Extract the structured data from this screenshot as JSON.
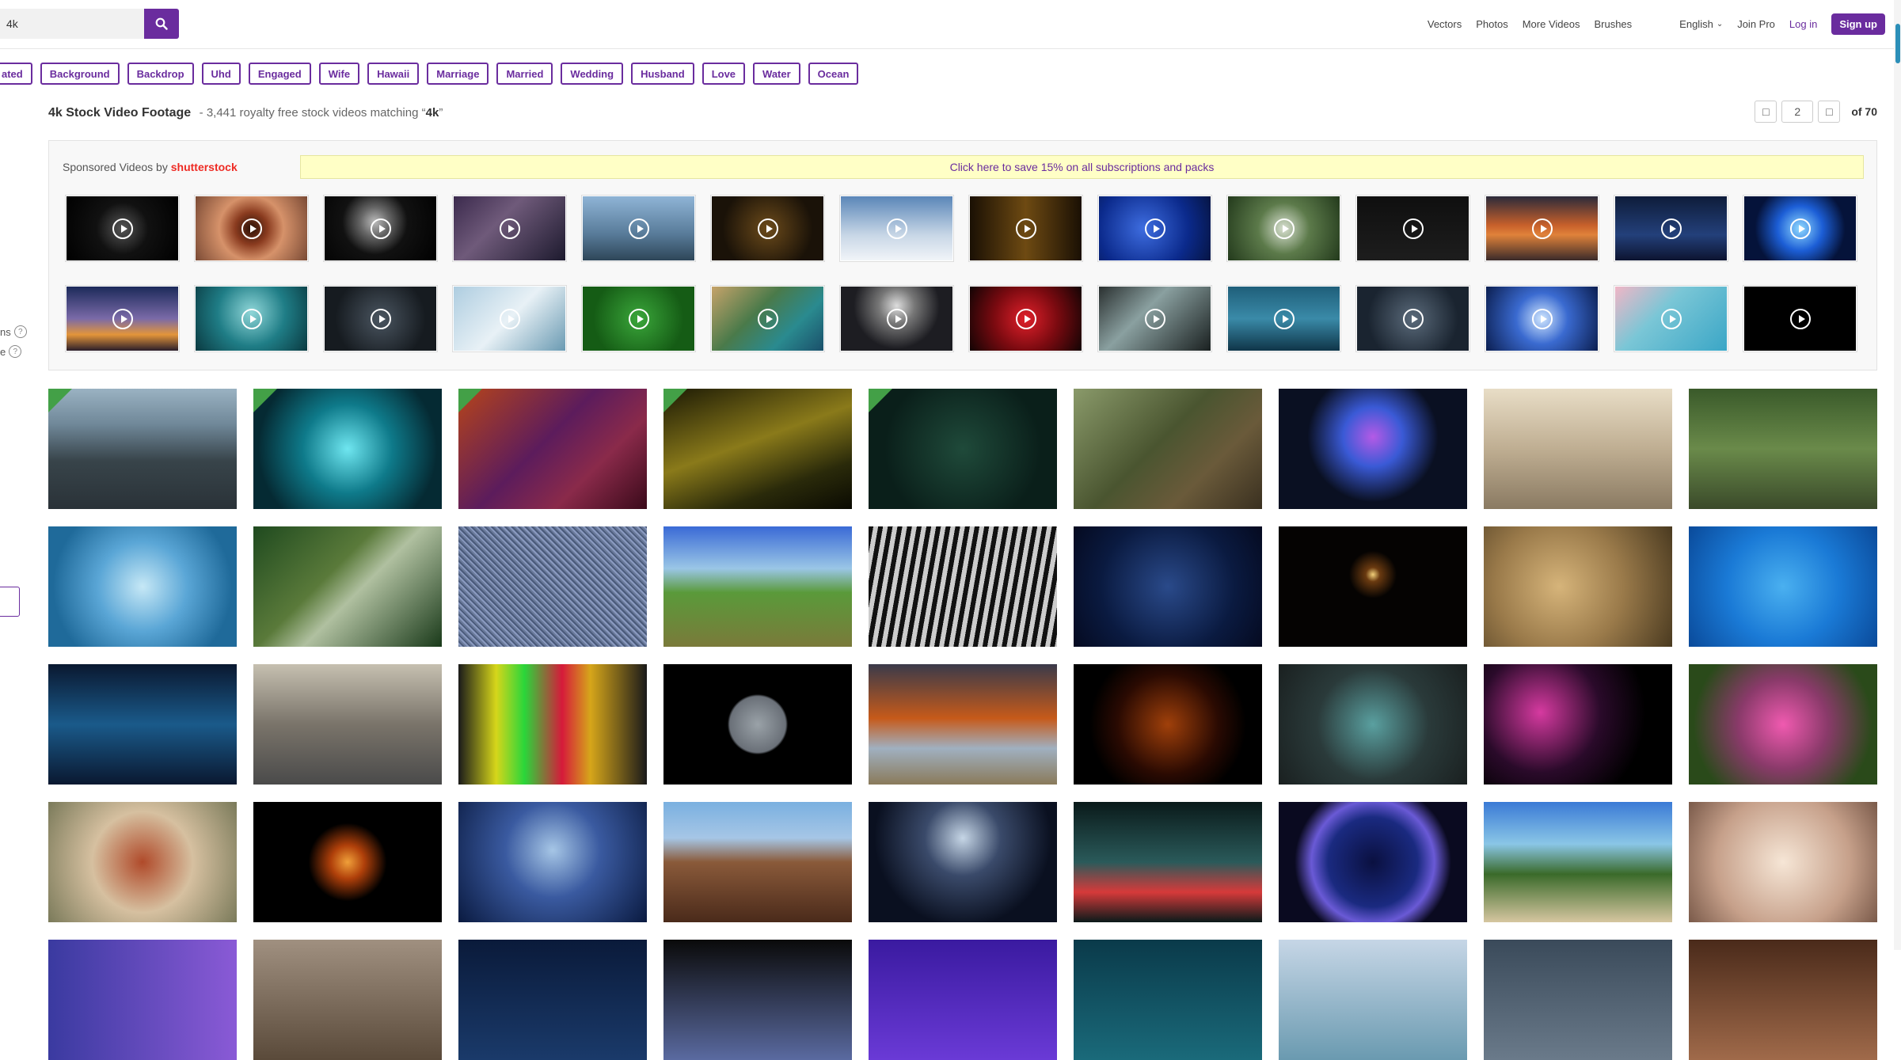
{
  "search": {
    "value": "4k",
    "placeholder": ""
  },
  "nav": {
    "links": [
      "Vectors",
      "Photos",
      "More Videos",
      "Brushes"
    ],
    "language": "English",
    "join_pro": "Join Pro",
    "login": "Log in",
    "signup": "Sign up"
  },
  "tags": [
    "ated",
    "Background",
    "Backdrop",
    "Uhd",
    "Engaged",
    "Wife",
    "Hawaii",
    "Marriage",
    "Married",
    "Wedding",
    "Husband",
    "Love",
    "Water",
    "Ocean"
  ],
  "heading": {
    "title": "4k Stock Video Footage",
    "subtitle": "- 3,441 royalty free stock videos matching “",
    "query": "4k",
    "close_quote": "”"
  },
  "pagination": {
    "current": "2",
    "total_label": "of 70"
  },
  "filters": {
    "fragment_1": "ns",
    "fragment_2": "e"
  },
  "sponsored": {
    "label": "Sponsored Videos by",
    "brand": "shutterstock",
    "promo": "Click here to save 15% on all subscriptions and packs"
  },
  "colors": {
    "accent": "#6a2c9e",
    "pro_badge": "#43a047",
    "promo_bg": "#ffffc6"
  },
  "sponsored_thumbs": [
    {
      "name": "dark-particles-ring",
      "bg": "radial-gradient(circle at 50% 50%, #555 0%, #111 40%, #000 100%)"
    },
    {
      "name": "eye-closeup",
      "bg": "radial-gradient(circle at 50% 50%, #2b1208 0%, #8a3b1f 25%, #d6926a 50%, #7a4a35 100%)"
    },
    {
      "name": "moon-dark",
      "bg": "radial-gradient(circle at 45% 40%, #bbb 0%, #666 20%, #111 45%, #000 100%)"
    },
    {
      "name": "galaxy",
      "bg": "linear-gradient(135deg, #3b2a4d, #6f5a7a 40%, #1d1a2e)"
    },
    {
      "name": "city-skyline",
      "bg": "linear-gradient(180deg, #8fb4d6, #577a98 60%, #2e4658)"
    },
    {
      "name": "gold-particles",
      "bg": "radial-gradient(circle at 50% 50%, #6b4a1a, #1a1208 70%)"
    },
    {
      "name": "clouds",
      "bg": "linear-gradient(180deg, #5a86b8, #c7d6e6 60%, #f1f4f8)"
    },
    {
      "name": "gold-chevrons",
      "bg": "linear-gradient(90deg, #1a1004, #6e4a12 50%, #1a1004)"
    },
    {
      "name": "blue-abstract",
      "bg": "radial-gradient(circle at 40% 50%, #3e6de0, #0b2a8c 60%, #061544)"
    },
    {
      "name": "forest-canopy",
      "bg": "radial-gradient(circle at 50% 50%, #d8e0d0, #5c7a4a 40%, #233a1c)"
    },
    {
      "name": "emoji-grid",
      "bg": "linear-gradient(180deg, #0f0f0f, #1d1d1d)"
    },
    {
      "name": "sunset-ocean",
      "bg": "linear-gradient(180deg, #2b2a3a, #c7602b 45%, #e0823a 60%, #3a2a2a)"
    },
    {
      "name": "night-city",
      "bg": "linear-gradient(180deg, #0e1c3a, #23407a 60%, #0d1430)"
    },
    {
      "name": "blue-ring",
      "bg": "radial-gradient(circle at 50% 50%, #8fd9ff, #1c5ed6 35%, #05133a 70%)"
    },
    {
      "name": "skyline-dusk",
      "bg": "linear-gradient(180deg, #1c2a5a, #7a6aa8 50%, #e3953a 75%, #2a1d2a)"
    },
    {
      "name": "underwater-teal",
      "bg": "radial-gradient(circle at 50% 40%, #8fd6d8, #1f7d86 50%, #0a3940)"
    },
    {
      "name": "dark-storm",
      "bg": "radial-gradient(circle at 50% 50%, #4a5560, #161b20 70%)"
    },
    {
      "name": "glacier",
      "bg": "linear-gradient(135deg, #aecde0, #e8f1f6 50%, #6a9ab2)"
    },
    {
      "name": "green-leaves",
      "bg": "radial-gradient(circle at 50% 50%, #3aa63a, #155c15 70%)"
    },
    {
      "name": "coast-aerial",
      "bg": "linear-gradient(135deg, #c6a36a, #4a7a4a 40%, #2a8a8f 70%, #1a4f6a)"
    },
    {
      "name": "moon-clouds",
      "bg": "radial-gradient(circle at 50% 30%, #ddd, #777 25%, #1d1d22 60%)"
    },
    {
      "name": "red-flower",
      "bg": "radial-gradient(circle at 50% 50%, #e0202a, #7a0a10 50%, #120404)"
    },
    {
      "name": "glass-architecture",
      "bg": "linear-gradient(135deg, #2a3030, #8aa0a0 40%, #1a2020)"
    },
    {
      "name": "ocean-waves",
      "bg": "linear-gradient(180deg, #1f5f7a, #3a8aa8 50%, #0f3548)"
    },
    {
      "name": "storm-clouds",
      "bg": "radial-gradient(circle at 50% 50%, #5a6a7a, #1a2430 70%)"
    },
    {
      "name": "digital-city",
      "bg": "radial-gradient(circle at 50% 50%, #cfe6ff, #3a6ad0 40%, #0b1e50)"
    },
    {
      "name": "turquoise-water",
      "bg": "linear-gradient(135deg, #f0b6c6, #7ac6d6 40%, #3aa6c6)"
    },
    {
      "name": "black",
      "bg": "#000000"
    }
  ],
  "videos": [
    {
      "name": "sea-rocks",
      "pro": true,
      "bg": "linear-gradient(180deg, #9ab2c2 0%, #6f8798 30%, #38444a 60%, #2a3238 100%)"
    },
    {
      "name": "cyan-tunnel",
      "pro": true,
      "bg": "radial-gradient(circle at 50% 50%, #6fe6f0, #0e7a8a 40%, #052a33 80%)"
    },
    {
      "name": "purple-particles",
      "pro": true,
      "bg": "linear-gradient(135deg, #b6441a, #5c1c5c 45%, #8a2a4a 70%, #3a0a1a)"
    },
    {
      "name": "gold-light-lines",
      "pro": true,
      "bg": "linear-gradient(160deg, #1c1a05, #8a7a1a 45%, #2a2a0a 75%, #0a0a02)"
    },
    {
      "name": "green-bokeh",
      "pro": true,
      "bg": "radial-gradient(circle at 50% 50%, #1f4a3a, #0a1f1a 70%)"
    },
    {
      "name": "rooster",
      "pro": false,
      "bg": "linear-gradient(135deg, #8a9a6a, #4a5530 45%, #6a5a3a 70%, #3a3020)"
    },
    {
      "name": "neon-shape",
      "pro": false,
      "bg": "radial-gradient(circle at 50% 40%, #b45ae6, #3a5ad6 25%, #0a1022 55%)"
    },
    {
      "name": "white-tiger",
      "pro": false,
      "bg": "linear-gradient(180deg, #e8ddc6, #bfae92 50%, #8a7a62)"
    },
    {
      "name": "black-bears",
      "pro": false,
      "bg": "linear-gradient(180deg, #3a5a2a, #6a8a4a 50%, #3a4a2a)"
    },
    {
      "name": "water-splash",
      "pro": false,
      "bg": "radial-gradient(circle at 50% 50%, #c6e8f6, #5aa6d6 40%, #1f6a9a 80%)"
    },
    {
      "name": "forest-stream",
      "pro": false,
      "bg": "linear-gradient(135deg, #1f4a1f, #5a7a3a 40%, #b0c0a0 55%, #1a3a1a)"
    },
    {
      "name": "tv-static",
      "pro": false,
      "bg": "repeating-linear-gradient(45deg, #6a7a9a 0 2px, #8a9ac0 2px 4px, #4a5a7a 4px 6px)"
    },
    {
      "name": "tropical-coast",
      "pro": false,
      "bg": "linear-gradient(180deg, #3a6ad6, #9ac6e6 35%, #5a9a3a 55%, #7a7a3a 100%)"
    },
    {
      "name": "zebras",
      "pro": false,
      "bg": "repeating-linear-gradient(100deg, #111 0 6px, #ccc 6px 12px)"
    },
    {
      "name": "blue-polygons",
      "pro": false,
      "bg": "radial-gradient(circle at 50% 50%, #2a4a8a, #0a1a40 60%, #050a20)"
    },
    {
      "name": "candle",
      "pro": false,
      "bg": "radial-gradient(circle at 50% 40%, #f2d07a 0%, #6a3a10 6%, #050302 20%)"
    },
    {
      "name": "pocket-watch",
      "pro": false,
      "bg": "radial-gradient(circle at 40% 50%, #d6b47a, #9a7a4a 50%, #4a3a20)"
    },
    {
      "name": "pool-water",
      "pro": false,
      "bg": "radial-gradient(circle at 50% 50%, #4ab0f0, #1a7ad6 50%, #0a4a9a)"
    },
    {
      "name": "digital-waves",
      "pro": false,
      "bg": "linear-gradient(180deg, #0a1830, #1a5a8a 50%, #0a1830)"
    },
    {
      "name": "city-street",
      "pro": false,
      "bg": "linear-gradient(180deg, #c6c0b0, #7a746a 50%, #4a4a4a)"
    },
    {
      "name": "color-bars",
      "pro": false,
      "bg": "linear-gradient(90deg, #1a1a1a, #d6d61a 20%, #2ad63a 35%, #d61a3a 55%, #d6a61a 70%, #1a1a1a)"
    },
    {
      "name": "moon",
      "pro": false,
      "bg": "radial-gradient(circle at 50% 50%, #9aa2a8 0%, #6a7078 25%, #000 27%)"
    },
    {
      "name": "autumn-tree",
      "pro": false,
      "bg": "linear-gradient(180deg, #3a3a4a, #c65a1a 45%, #a0b0c0 70%, #8a7a5a)"
    },
    {
      "name": "orange-sparks",
      "pro": false,
      "bg": "radial-gradient(circle at 50% 50%, #a0400a, #2a0a02 45%, #000 70%)"
    },
    {
      "name": "hud-interface",
      "pro": false,
      "bg": "radial-gradient(circle at 50% 50%, #5aa0a0, #2a3a3a 50%, #1a2020)"
    },
    {
      "name": "fireworks",
      "pro": false,
      "bg": "radial-gradient(circle at 30% 40%, #d63aa0, #2a0a2a 40%, #000 70%)"
    },
    {
      "name": "pink-flowers",
      "pro": false,
      "bg": "radial-gradient(circle at 50% 50%, #f05ab0, #8a3a6a 40%, #2a4a1a 80%)"
    },
    {
      "name": "autumn-leaves",
      "pro": false,
      "bg": "radial-gradient(circle at 50% 50%, #b04a2a, #d6c0a0 45%, #7a7a5a)"
    },
    {
      "name": "fireball",
      "pro": false,
      "bg": "radial-gradient(circle at 50% 50%, #f0a03a 0%, #b0400a 15%, #000 35%)"
    },
    {
      "name": "space-nebula",
      "pro": false,
      "bg": "radial-gradient(circle at 50% 40%, #a6c6e6, #3a5aa0 40%, #0a1a40)"
    },
    {
      "name": "mountain",
      "pro": false,
      "bg": "linear-gradient(180deg, #7ab0e0, #a6c6e6 30%, #8a5a3a 50%, #4a2a1a)"
    },
    {
      "name": "foggy-forest",
      "pro": false,
      "bg": "radial-gradient(circle at 50% 30%, #c6d6e6, #3a4a6a 30%, #0a1020 70%)"
    },
    {
      "name": "neon-grid",
      "pro": false,
      "bg": "linear-gradient(180deg, #0a1a1a, #2a5a5a 50%, #d63a3a 75%, #0a1a1a)"
    },
    {
      "name": "blue-orb",
      "pro": false,
      "bg": "radial-gradient(circle at 50% 50%, #0a1040, #1a2a80 40%, #6a5ad6 55%, #0a0a20 70%)"
    },
    {
      "name": "palm-beach",
      "pro": false,
      "bg": "linear-gradient(180deg, #3a7ad6, #8ac6e6 35%, #3a6a2a 60%, #d6c6a0 100%)"
    },
    {
      "name": "soft-bokeh",
      "pro": false,
      "bg": "radial-gradient(circle at 50% 50%, #f6e6d6, #c6a08a 60%, #7a5a4a)"
    },
    {
      "name": "row5-1",
      "pro": false,
      "bg": "linear-gradient(90deg, #3a3aa0, #8a5ad6)"
    },
    {
      "name": "row5-2",
      "pro": false,
      "bg": "linear-gradient(180deg, #a09080, #5a4a3a)"
    },
    {
      "name": "row5-3",
      "pro": false,
      "bg": "linear-gradient(180deg, #0a1a3a, #1a3a6a)"
    },
    {
      "name": "row5-4",
      "pro": false,
      "bg": "linear-gradient(180deg, #0a0a0a, #5a6aa0)"
    },
    {
      "name": "row5-5",
      "pro": false,
      "bg": "linear-gradient(180deg, #3a1aa0, #6a3ad6)"
    },
    {
      "name": "row5-6",
      "pro": false,
      "bg": "linear-gradient(180deg, #0a3a4a, #1a6a7a)"
    },
    {
      "name": "row5-7",
      "pro": false,
      "bg": "linear-gradient(180deg, #c6d6e6, #6a9ab0)"
    },
    {
      "name": "row5-8",
      "pro": false,
      "bg": "linear-gradient(180deg, #3a4a5a, #6a7a8a)"
    },
    {
      "name": "row5-9",
      "pro": false,
      "bg": "linear-gradient(180deg, #4a2a1a, #a06a4a)"
    }
  ]
}
